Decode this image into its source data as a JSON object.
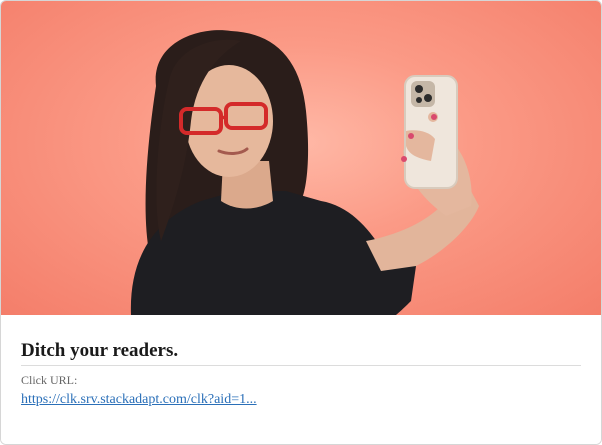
{
  "ad": {
    "image_alt": "Woman taking a selfie wearing red reading glasses",
    "headline": "Ditch your readers.",
    "click_label": "Click URL:",
    "click_url": "https://clk.srv.stackadapt.com/clk?aid=1..."
  },
  "colors": {
    "background_peach": "#fb9a86",
    "link_blue": "#2a6fb8",
    "glasses_red": "#d42a2a"
  }
}
